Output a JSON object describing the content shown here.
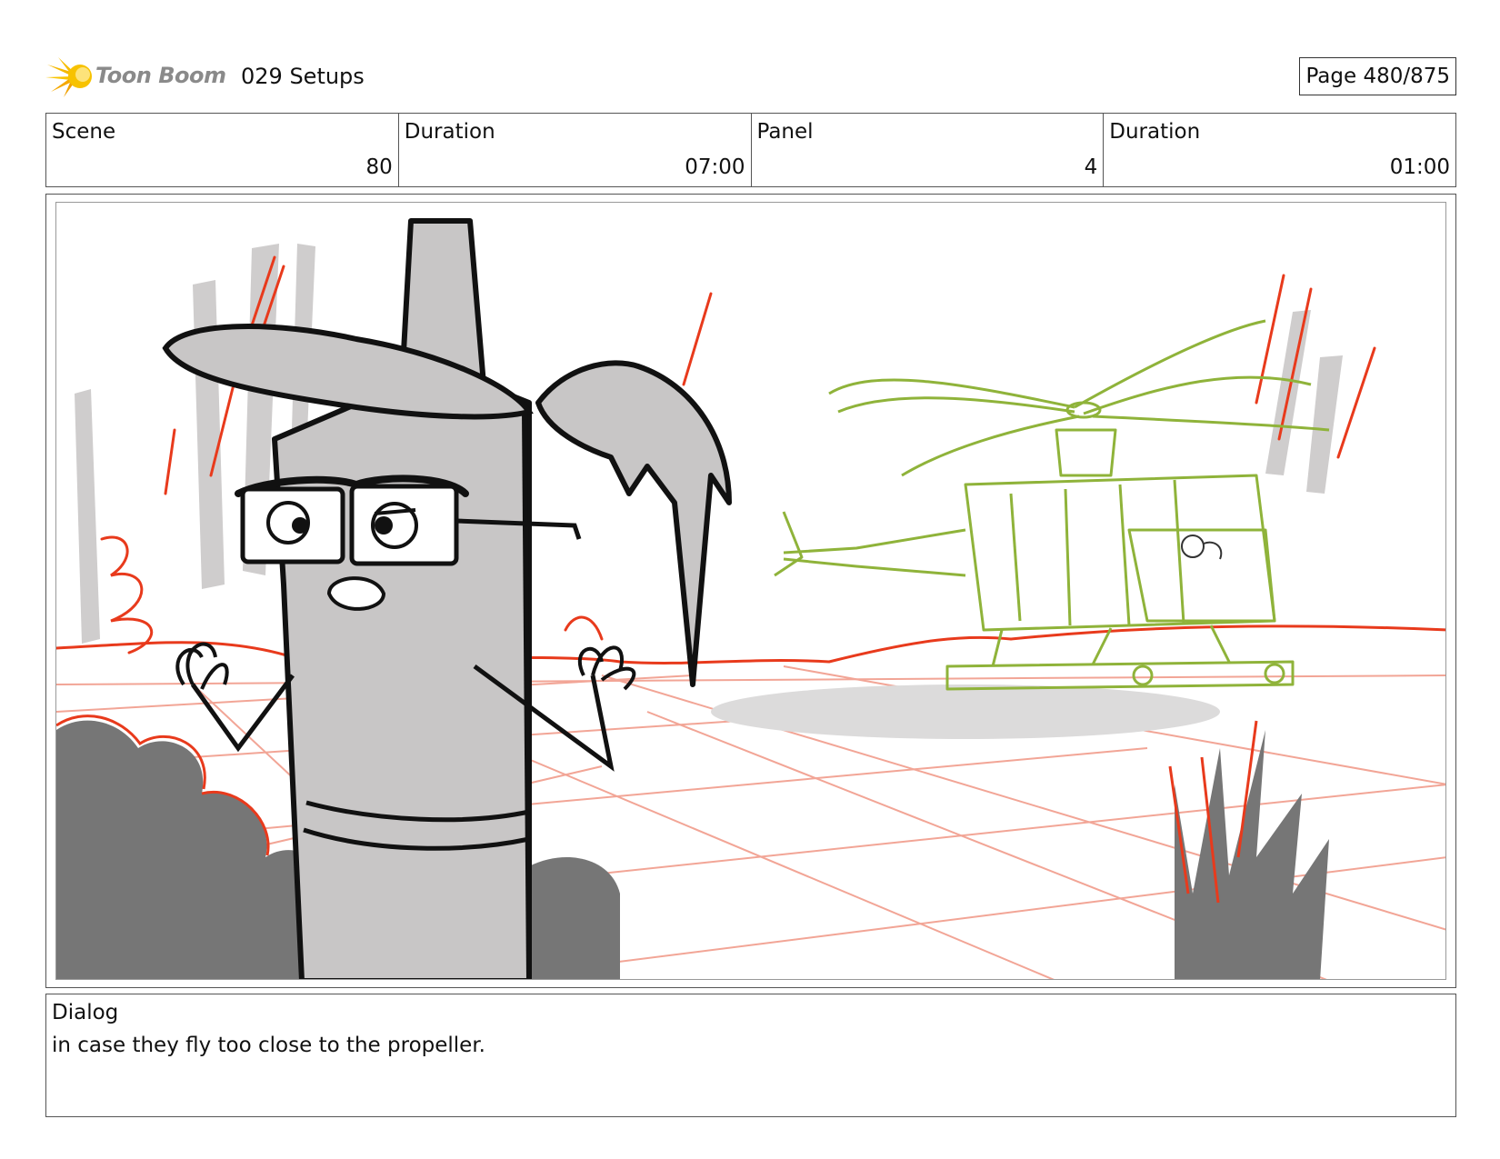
{
  "header": {
    "logo_text": "Toon Boom",
    "project_title": "029 Setups",
    "page_label": "Page 480/875"
  },
  "info": {
    "scene_label": "Scene",
    "scene_value": "80",
    "scene_duration_label": "Duration",
    "scene_duration_value": "07:00",
    "panel_label": "Panel",
    "panel_value": "4",
    "panel_duration_label": "Duration",
    "panel_duration_value": "01:00"
  },
  "dialog": {
    "label": "Dialog",
    "text": "in case they fly too close to the propeller."
  },
  "colors": {
    "sketch_red": "#e83a1c",
    "sketch_green": "#8fb33a",
    "sketch_gray": "#c8c6c6",
    "shadow_gray": "#7a7a7a",
    "logo_yellow": "#f5b800"
  }
}
